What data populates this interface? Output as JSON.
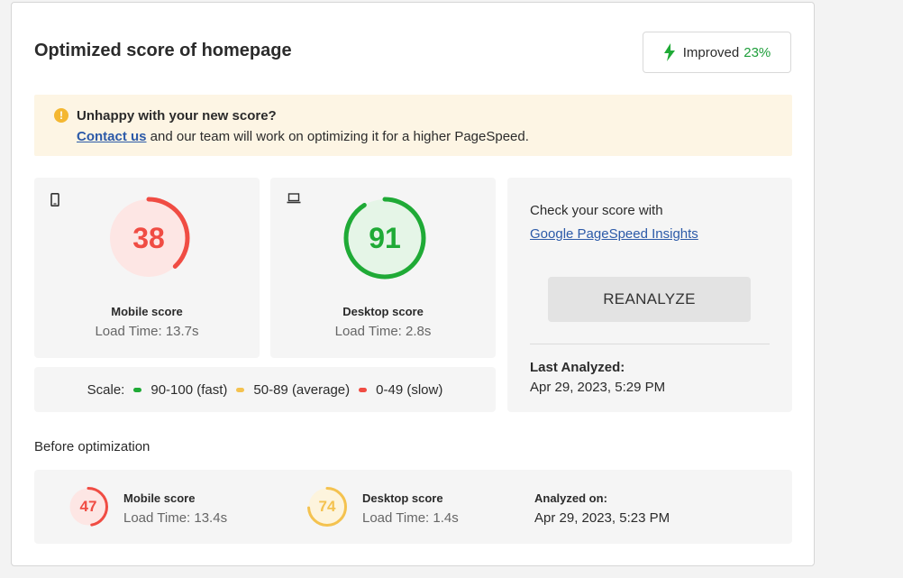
{
  "header": {
    "title": "Optimized score of homepage",
    "improved_label": "Improved",
    "improved_value": "23%"
  },
  "notice": {
    "heading": "Unhappy with your new score?",
    "link_text": "Contact us",
    "body_text": " and our team will work on optimizing it for a higher PageSpeed."
  },
  "mobile": {
    "score": "38",
    "label": "Mobile score",
    "load_time": "Load Time: 13.7s",
    "score_fraction": 0.38,
    "color": "#f04c43",
    "icon": "mobile-phone-icon"
  },
  "desktop": {
    "score": "91",
    "label": "Desktop score",
    "load_time": "Load Time: 2.8s",
    "score_fraction": 0.91,
    "color": "#1faa36",
    "icon": "laptop-icon"
  },
  "scale": {
    "label": "Scale:",
    "fast": "90-100 (fast)",
    "average": "50-89 (average)",
    "slow": "0-49 (slow)",
    "fast_color": "#1faa36",
    "average_color": "#f4c24f",
    "slow_color": "#f04c43"
  },
  "check": {
    "title": "Check your score with",
    "link": "Google PageSpeed Insights",
    "button": "REANALYZE",
    "last_label": "Last Analyzed:",
    "last_date": "Apr 29, 2023, 5:29 PM"
  },
  "before": {
    "title": "Before optimization",
    "mobile": {
      "score": "47",
      "label": "Mobile score",
      "load_time": "Load Time: 13.4s",
      "score_fraction": 0.47,
      "color": "#f04c43"
    },
    "desktop": {
      "score": "74",
      "label": "Desktop score",
      "load_time": "Load Time: 1.4s",
      "score_fraction": 0.74,
      "color": "#f4c24f"
    },
    "analyzed_label": "Analyzed on:",
    "analyzed_date": "Apr 29, 2023, 5:23 PM"
  }
}
